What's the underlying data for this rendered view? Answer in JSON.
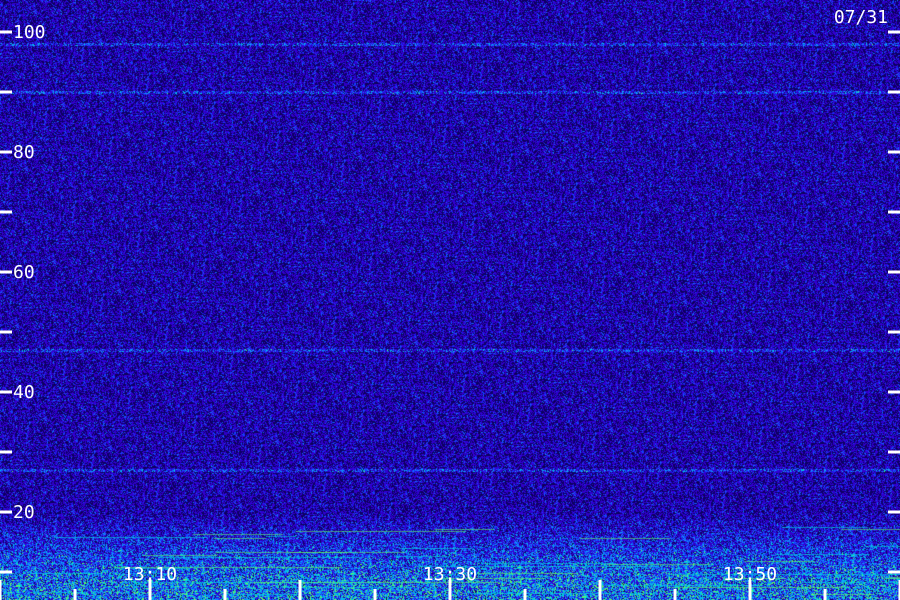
{
  "date_label": "07/31",
  "chart_data": {
    "type": "heatmap",
    "title": "",
    "xlabel": "",
    "ylabel": "",
    "ylim": [
      0,
      100
    ],
    "y_ticks_labeled": [
      20,
      40,
      60,
      80,
      100
    ],
    "y_ticks_minor": [
      10,
      30,
      50,
      70,
      90
    ],
    "x_range": [
      "13:00",
      "14:00"
    ],
    "x_ticks_labeled": [
      {
        "time": "13:10",
        "label": "13:10"
      },
      {
        "time": "13:30",
        "label": "13:30"
      },
      {
        "time": "13:50",
        "label": "13:50"
      }
    ],
    "x_ticks_major": [
      "13:00",
      "13:10",
      "13:20",
      "13:30",
      "13:40",
      "13:50",
      "14:00"
    ],
    "x_ticks_minor": [
      "13:05",
      "13:15",
      "13:25",
      "13:35",
      "13:45",
      "13:55"
    ],
    "steady_bands": [
      98,
      90,
      47,
      27
    ],
    "activity_band": [
      0,
      20
    ],
    "colors": {
      "background": "#14006a",
      "low": "#2a00b0",
      "mid": "#0050ff",
      "high": "#00e0e0",
      "peak": "#60ff60",
      "axis": "#ffffff"
    }
  }
}
